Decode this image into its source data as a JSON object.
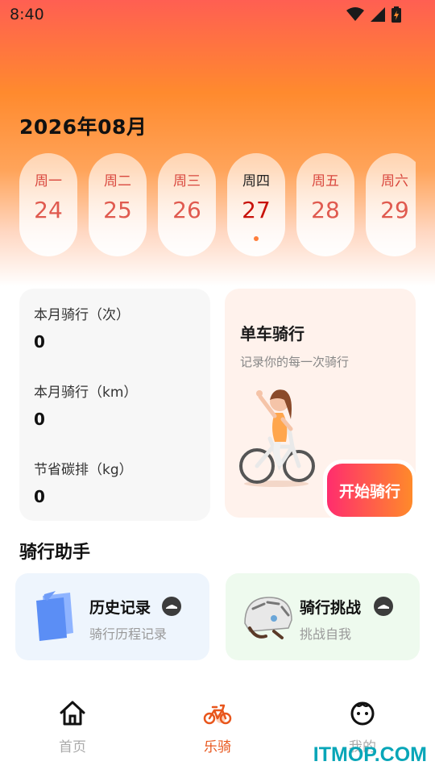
{
  "status_bar": {
    "time": "8:40"
  },
  "calendar": {
    "month_title": "2026年08月",
    "days": [
      {
        "weekday": "周一",
        "date": "24"
      },
      {
        "weekday": "周二",
        "date": "25"
      },
      {
        "weekday": "周三",
        "date": "26"
      },
      {
        "weekday": "周四",
        "date": "27",
        "selected": true
      },
      {
        "weekday": "周五",
        "date": "28"
      },
      {
        "weekday": "周六",
        "date": "29"
      }
    ]
  },
  "stats": {
    "rides_label": "本月骑行（次）",
    "rides_value": "0",
    "distance_label": "本月骑行（km）",
    "distance_value": "0",
    "carbon_label": "节省碳排（kg）",
    "carbon_value": "0"
  },
  "ride_card": {
    "title": "单车骑行",
    "subtitle": "记录你的每一次骑行",
    "start_label": "开始骑行"
  },
  "assistant": {
    "section_title": "骑行助手",
    "history": {
      "title": "历史记录",
      "subtitle": "骑行历程记录",
      "icon": "notebook-icon"
    },
    "challenge": {
      "title": "骑行挑战",
      "subtitle": "挑战自我",
      "icon": "helmet-icon"
    }
  },
  "nav": {
    "home": "首页",
    "ride": "乐骑",
    "mine": "我的"
  },
  "watermark": "ITMOP.COM",
  "colors": {
    "accent": "#e8561c",
    "gradient_top": "#ff5f52",
    "gradient_mid": "#ff8a2e"
  }
}
